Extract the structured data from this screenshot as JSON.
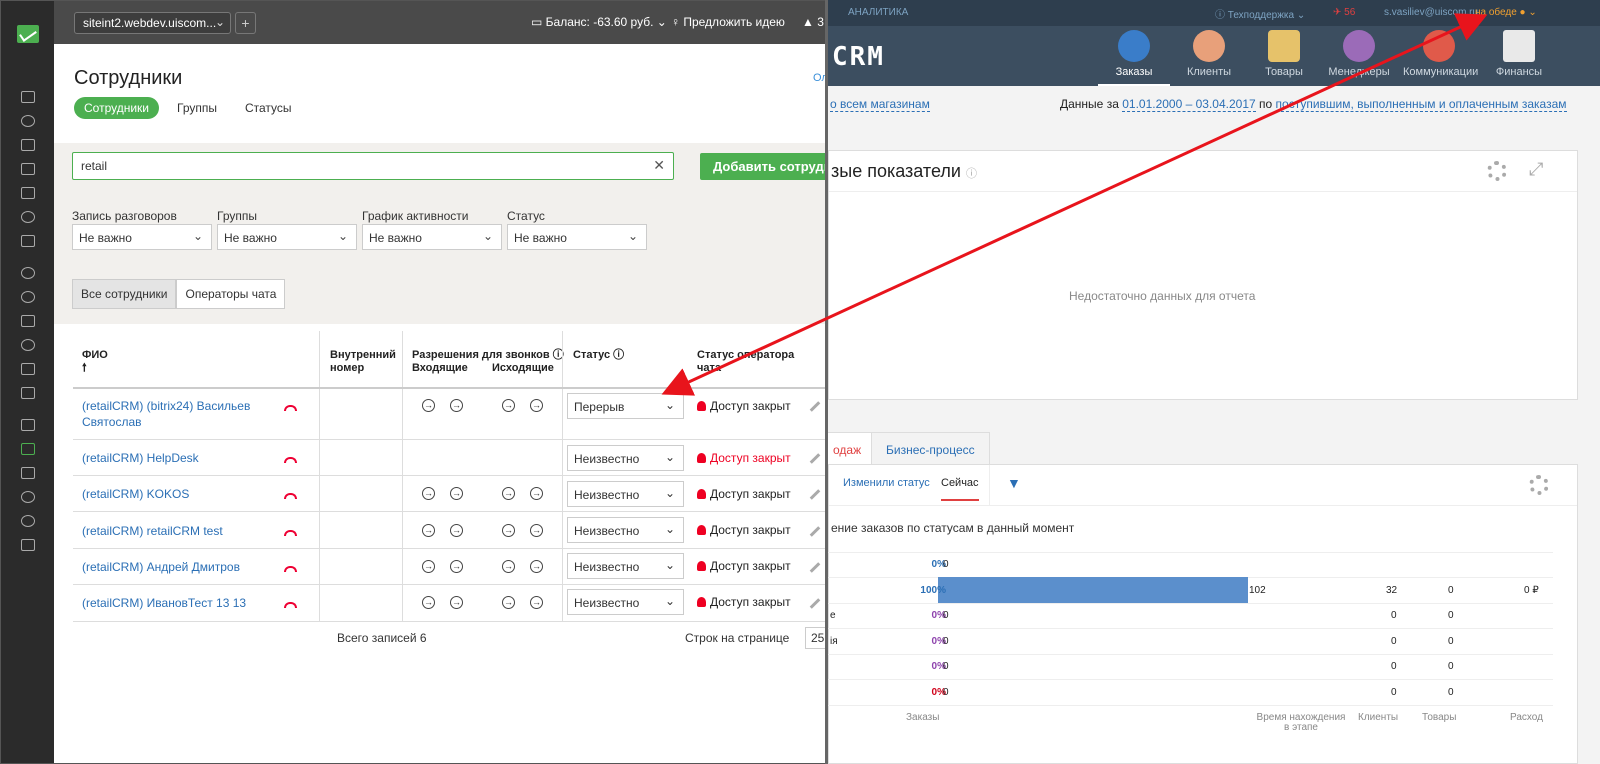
{
  "left": {
    "site_select": "siteint2.webdev.uiscom...",
    "balance": "Баланс: -63.60 руб.",
    "suggest": "Предложить идею",
    "bell_count": "3",
    "title": "Сотрудники",
    "topright": "Ол",
    "tabs": [
      "Сотрудники",
      "Группы",
      "Статусы"
    ],
    "search_value": "retail",
    "add_button": "Добавить сотрудника",
    "filters": [
      {
        "label": "Запись разговоров",
        "value": "Не важно"
      },
      {
        "label": "Группы",
        "value": "Не важно"
      },
      {
        "label": "График активности",
        "value": "Не важно"
      },
      {
        "label": "Статус",
        "value": "Не важно"
      }
    ],
    "segments": [
      "Все сотрудники",
      "Операторы чата"
    ],
    "headers": {
      "fio": "ФИО",
      "internal": "Внутренний номер",
      "permissions": "Разрешения для звонков",
      "incoming": "Входящие",
      "outgoing": "Исходящие",
      "status": "Статус",
      "chat_status": "Статус оператора чата"
    },
    "rows": [
      {
        "name": "(retailCRM) (bitrix24) Васильев Святослав",
        "status": "Перерыв",
        "access": "Доступ закрыт",
        "access_red": false
      },
      {
        "name": "(retailCRM) HelpDesk",
        "status": "Неизвестно",
        "access": "Доступ закрыт",
        "access_red": true
      },
      {
        "name": "(retailCRM) KOKOS",
        "status": "Неизвестно",
        "access": "Доступ закрыт",
        "access_red": false
      },
      {
        "name": "(retailCRM) retailCRM test",
        "status": "Неизвестно",
        "access": "Доступ закрыт",
        "access_red": false
      },
      {
        "name": "(retailCRM) Андрей Дмитров",
        "status": "Неизвестно",
        "access": "Доступ закрыт",
        "access_red": false
      },
      {
        "name": "(retailCRM) ИвановТест 13 13",
        "status": "Неизвестно",
        "access": "Доступ закрыт",
        "access_red": false
      }
    ],
    "total": "Всего записей 6",
    "rows_per_page_label": "Строк на странице",
    "rows_per_page": "25"
  },
  "right": {
    "top_analytics": "АНАЛИТИКА",
    "top_support": "Техподдержка",
    "top_count": "56",
    "top_user": "s.vasiliev@uiscom.ru",
    "top_status": "на обеде",
    "logo": "CRM",
    "nav": [
      "Заказы",
      "Клиенты",
      "Товары",
      "Менеджеры",
      "Коммуникации",
      "Финансы"
    ],
    "all_shops": "о всем магазинам",
    "data_for": "Данные за",
    "period": "01.01.2000 – 03.04.2017",
    "by": "по",
    "order_types": "поступившим, выполненным и оплаченным заказам",
    "panel_title": "зые показатели",
    "no_data": "Недостаточно данных для отчета",
    "tab_sales": "одаж",
    "tab_bp": "Бизнес-процесс",
    "sub_changed": "Изменили статус",
    "sub_now": "Сейчас",
    "section_title": "ение заказов по статусам в данный момент",
    "stat_rows": [
      {
        "label": "",
        "pct": "0%",
        "orders": "0",
        "clients": "",
        "goods": "",
        "expense": "",
        "color": "#2b6fb5"
      },
      {
        "label": "",
        "pct": "100%",
        "orders": "102",
        "clients": "32",
        "goods": "0",
        "expense": "0 ₽",
        "color": "#2b6fb5"
      },
      {
        "label": "е",
        "pct": "0%",
        "orders": "0",
        "clients": "0",
        "goods": "0",
        "expense": "",
        "color": "#8e44ad"
      },
      {
        "label": "ія",
        "pct": "0%",
        "orders": "0",
        "clients": "0",
        "goods": "0",
        "expense": "",
        "color": "#8e44ad"
      },
      {
        "label": "",
        "pct": "0%",
        "orders": "0",
        "clients": "0",
        "goods": "0",
        "expense": "",
        "color": "#8e44ad"
      },
      {
        "label": "",
        "pct": "0%",
        "orders": "0",
        "clients": "0",
        "goods": "0",
        "expense": "",
        "color": "#d0021b"
      }
    ],
    "bar_fraction": 1.0,
    "col_orders": "Заказы",
    "col_time": "Время нахождения в этапе",
    "col_clients": "Клиенты",
    "col_goods": "Товары",
    "col_expense": "Расход"
  }
}
